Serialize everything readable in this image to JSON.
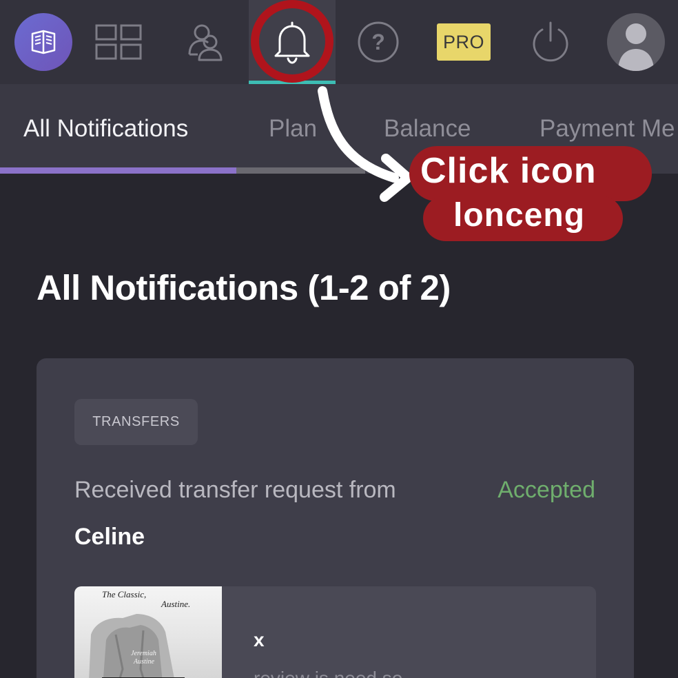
{
  "nav": {
    "items": [
      {
        "icon": "logo-icon"
      },
      {
        "icon": "dashboard-grid-icon"
      },
      {
        "icon": "users-icon"
      },
      {
        "icon": "bell-icon",
        "active": true
      },
      {
        "icon": "help-icon"
      },
      {
        "label": "PRO"
      },
      {
        "icon": "power-icon"
      },
      {
        "icon": "avatar-icon"
      }
    ]
  },
  "tabs": [
    {
      "label": "All Notifications",
      "active": true
    },
    {
      "label": "Plan"
    },
    {
      "label": "Balance"
    },
    {
      "label": "Payment Me"
    }
  ],
  "page_title": "All Notifications (1-2 of 2)",
  "notification": {
    "category": "TRANSFERS",
    "text": "Received transfer request from",
    "status": "Accepted",
    "sender": "Celine",
    "item": {
      "cover_line1": "The Classic,",
      "cover_line2": "Austine.",
      "cover_line3": "Jeremiah",
      "cover_line4": "Austine",
      "title": "x",
      "subtitle": "review is need so"
    }
  },
  "annotation": {
    "line1": "Click icon",
    "line2": "lonceng"
  },
  "colors": {
    "accent_teal": "#3dbdb4",
    "accent_purple": "#8b72c9",
    "status_green": "#6fae6d",
    "highlight_red": "#b0141c"
  }
}
